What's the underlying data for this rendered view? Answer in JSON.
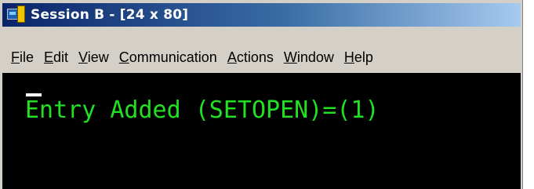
{
  "window": {
    "title": "Session B - [24 x 80]",
    "icon": "pcomm-session-icon"
  },
  "menu": {
    "items": [
      {
        "accel": "F",
        "rest": "ile"
      },
      {
        "accel": "E",
        "rest": "dit"
      },
      {
        "accel": "V",
        "rest": "iew"
      },
      {
        "accel": "C",
        "rest": "ommunication"
      },
      {
        "accel": "A",
        "rest": "ctions"
      },
      {
        "accel": "W",
        "rest": "indow"
      },
      {
        "accel": "H",
        "rest": "elp"
      }
    ]
  },
  "terminal": {
    "line1": "Entry Added (SETOPEN)=(1)",
    "text_color": "#22e022",
    "background": "#000000"
  },
  "colors": {
    "titlebar_start": "#0a246a",
    "titlebar_end": "#a6caf0",
    "chrome": "#d4d0c8"
  }
}
